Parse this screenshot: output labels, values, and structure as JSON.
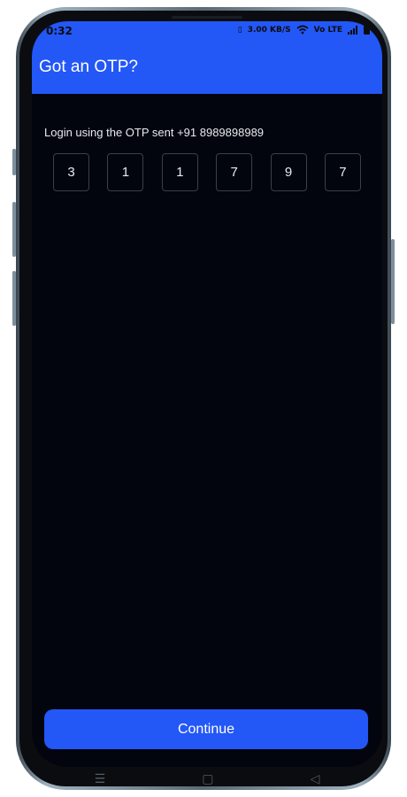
{
  "status_bar": {
    "time": "0:32",
    "network_speed": "3.00 KB/S",
    "volte": "Vo LTE"
  },
  "app_bar": {
    "title": "Got an OTP?"
  },
  "otp": {
    "prompt": "Login using the OTP sent +91 8989898989",
    "digits": [
      "3",
      "1",
      "1",
      "7",
      "9",
      "7"
    ]
  },
  "actions": {
    "continue_label": "Continue"
  },
  "nav_bar": {
    "menu_icon": "☰",
    "home_icon": "▢",
    "back_icon": "◁"
  },
  "colors": {
    "accent": "#2357f6",
    "background": "#02050e"
  }
}
